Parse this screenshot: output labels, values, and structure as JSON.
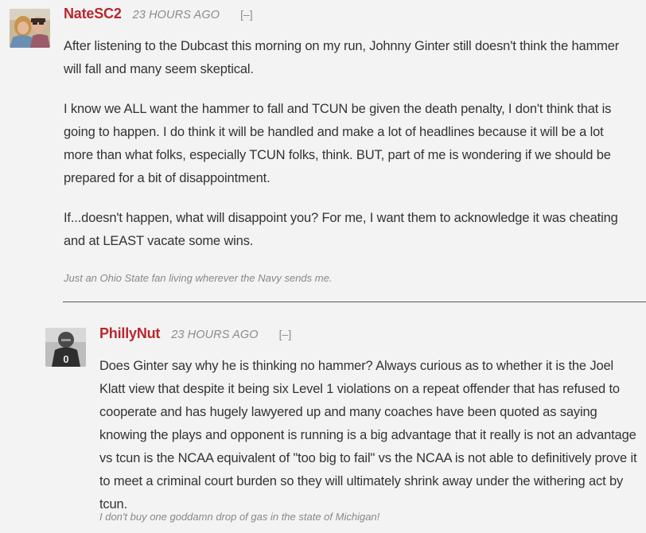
{
  "comments": [
    {
      "author": "NateSC2",
      "time": "23 HOURS AGO",
      "collapse": "[–]",
      "paragraphs": [
        "After listening to the Dubcast this morning on my run, Johnny Ginter still doesn't think the hammer will fall and many seem skeptical.",
        "I know we ALL want the hammer to fall and TCUN be given the death penalty, I don't think that is going to happen. I do think it will be handled and make a lot of headlines because it will be a lot more than what folks, especially TCUN folks, think. BUT, part of me is wondering if we should be prepared for a bit of disappointment.",
        "If...doesn't happen, what will disappoint you?  For me, I want them to acknowledge it was cheating and at LEAST vacate some wins."
      ],
      "signature": "Just an Ohio State fan living wherever the Navy sends me."
    },
    {
      "author": "PhillyNut",
      "time": "23 HOURS AGO",
      "collapse": "[–]",
      "paragraphs": [
        "Does Ginter say why he is thinking no hammer? Always curious as to whether it is the Joel Klatt view that despite it being six Level 1 violations on a repeat offender that has refused to cooperate and has hugely lawyered up and many coaches have been quoted as saying knowing the plays and opponent is running is a big advantage that it really is not an advantage vs tcun is the NCAA equivalent of \"too big to fail\" vs the NCAA is not able to definitively prove it to meet a criminal court burden so they will ultimately shrink away under the withering act by tcun."
      ],
      "signature": "I don't buy one goddamn drop of gas in the state of Michigan!",
      "avatar_jersey_number": "0"
    }
  ],
  "colors": {
    "author": "#b8262e",
    "meta": "#8c8c8c",
    "text": "#333333",
    "background": "#f3f3f3"
  }
}
